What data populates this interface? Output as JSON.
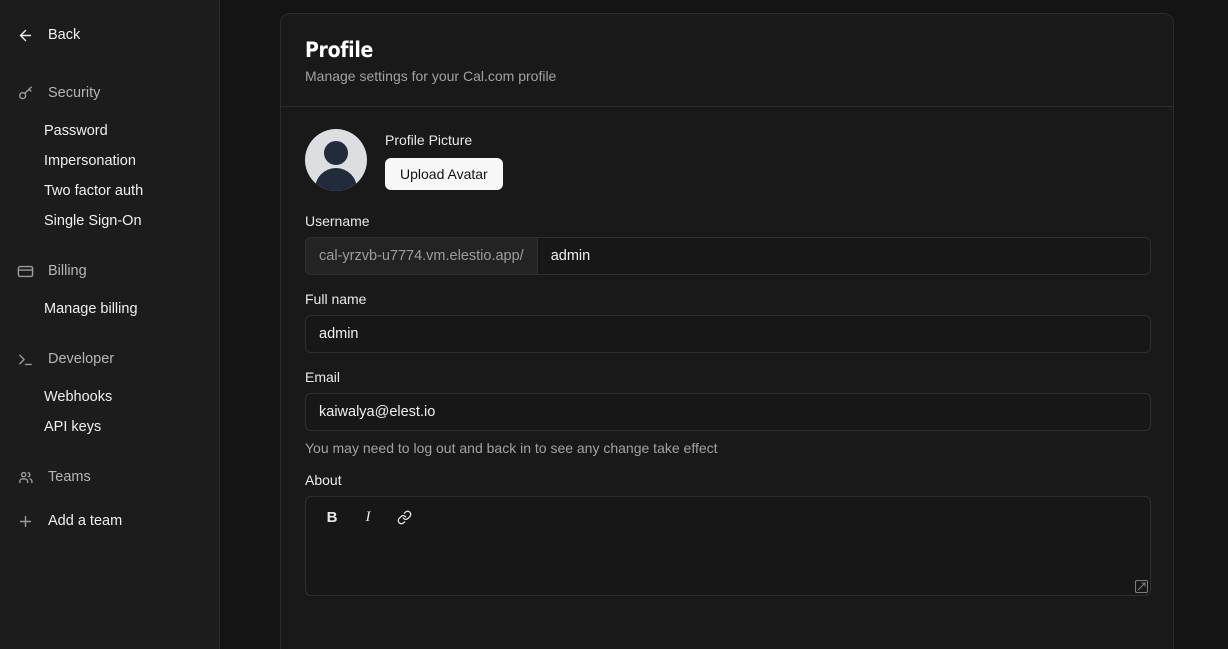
{
  "sidebar": {
    "back": {
      "label": "Back",
      "icon": "arrow-left-icon"
    },
    "groups": [
      {
        "label": "Security",
        "icon": "key-icon",
        "items": [
          {
            "label": "Password"
          },
          {
            "label": "Impersonation"
          },
          {
            "label": "Two factor auth"
          },
          {
            "label": "Single Sign-On"
          }
        ]
      },
      {
        "label": "Billing",
        "icon": "credit-card-icon",
        "items": [
          {
            "label": "Manage billing"
          }
        ]
      },
      {
        "label": "Developer",
        "icon": "terminal-icon",
        "items": [
          {
            "label": "Webhooks"
          },
          {
            "label": "API keys"
          }
        ]
      },
      {
        "label": "Teams",
        "icon": "users-icon",
        "items": []
      }
    ],
    "add_team": {
      "label": "Add a team",
      "icon": "plus-icon"
    }
  },
  "page": {
    "title": "Profile",
    "subtitle": "Manage settings for your Cal.com profile"
  },
  "profile_picture": {
    "label": "Profile Picture",
    "upload_label": "Upload Avatar",
    "avatar_icon": "person-avatar-icon"
  },
  "form": {
    "username": {
      "label": "Username",
      "prefix": "cal-yrzvb-u7774.vm.elestio.app/",
      "value": "admin",
      "placeholder": "username"
    },
    "fullname": {
      "label": "Full name",
      "value": "admin",
      "placeholder": "Your name"
    },
    "email": {
      "label": "Email",
      "value": "kaiwalya@elest.io",
      "placeholder": "you@example.com",
      "helper": "You may need to log out and back in to see any change take effect"
    },
    "about": {
      "label": "About",
      "value": "",
      "placeholder": "",
      "toolbar": [
        {
          "name": "bold",
          "glyph": "B"
        },
        {
          "name": "italic",
          "glyph": "I"
        },
        {
          "name": "link",
          "glyph": "link-icon"
        }
      ]
    }
  },
  "colors": {
    "page_bg": "#141414",
    "sidebar_bg": "#1c1c1c",
    "card_bg": "#191919",
    "border": "#2c2c2c",
    "input_bg": "#171717",
    "accent_button_bg": "#f7f7f7",
    "avatar_bg": "#dcdee2",
    "avatar_fg": "#232b3a"
  }
}
